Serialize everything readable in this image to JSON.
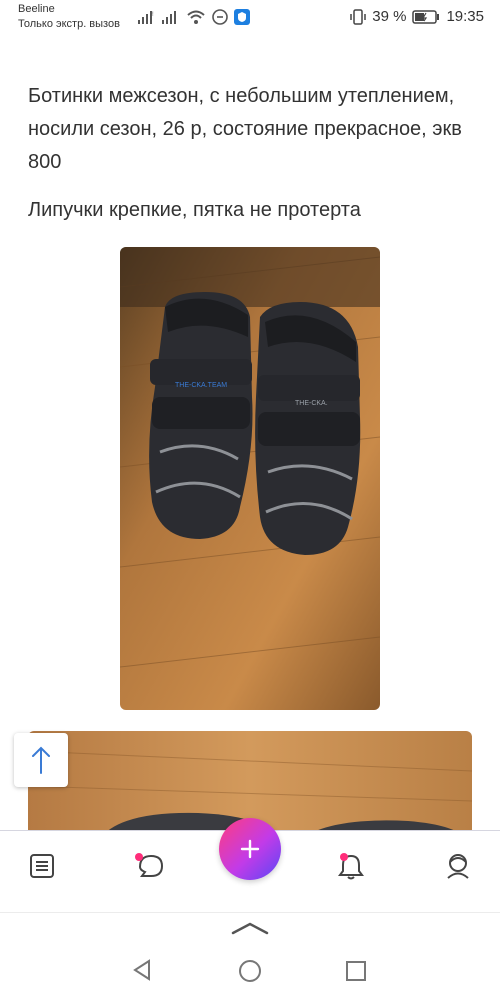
{
  "status_bar": {
    "carrier": "Beeline",
    "carrier_status": "Только экстр. вызов",
    "battery": "39 %",
    "time": "19:35"
  },
  "post": {
    "text_line1": "Ботинки межсезон, с небольшим утеплением, носили сезон, 26 р, состояние прекрасное, экв 800",
    "text_line2": "Липучки крепкие, пятка не протерта"
  },
  "icons": {
    "scroll_top": "arrow-up-icon",
    "nav": [
      "feed-icon",
      "chat-icon",
      "add-icon",
      "bell-icon",
      "profile-icon"
    ]
  },
  "colors": {
    "fab_gradient": [
      "#ff3d7f",
      "#c23be8",
      "#5a47f5"
    ],
    "notification_dot": "#ff2d7a",
    "nav_border": "#d6d6e0"
  }
}
